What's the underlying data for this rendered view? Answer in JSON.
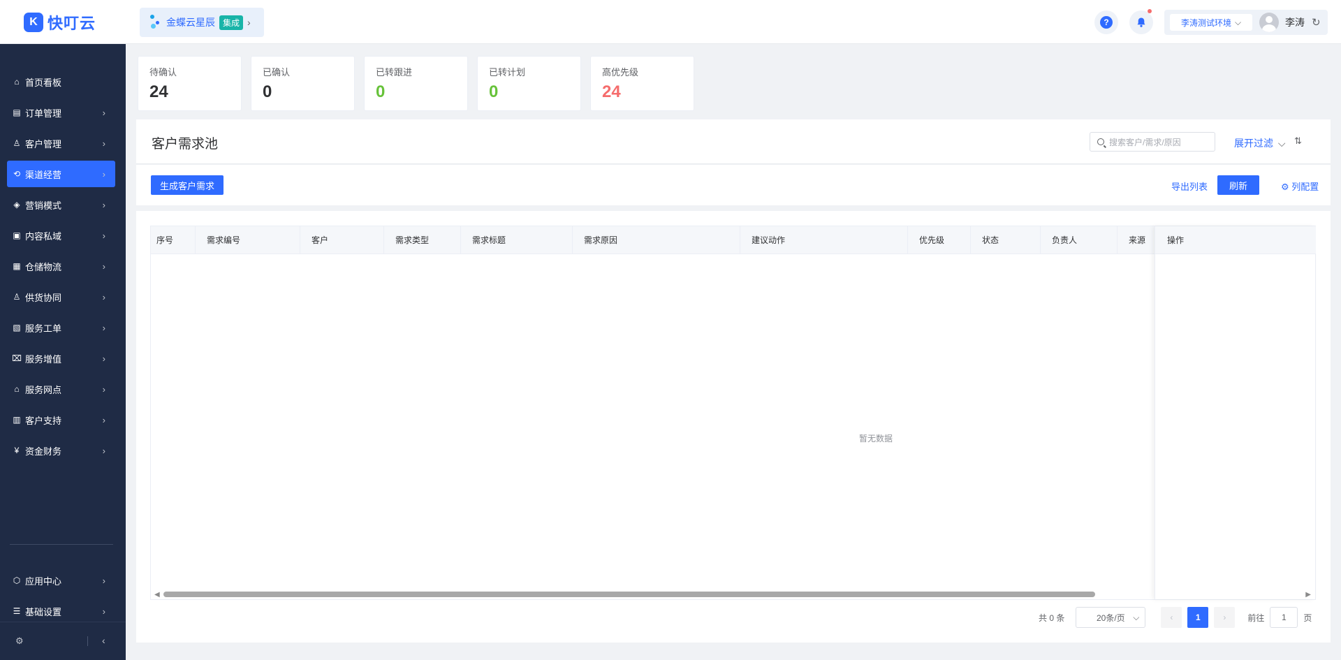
{
  "header": {
    "logo_text": "快叮云",
    "logo_glyph": "K",
    "integration": {
      "name": "金蝶云星辰",
      "badge": "集成"
    },
    "help_glyph": "?",
    "env_select": "李涛测试环境",
    "username": "李涛"
  },
  "sidebar": {
    "items": [
      {
        "label": "首页看板",
        "icon": "home-icon",
        "glyph": "⌂"
      },
      {
        "label": "订单管理",
        "icon": "order-icon",
        "glyph": "▤"
      },
      {
        "label": "客户管理",
        "icon": "user-icon",
        "glyph": "♙"
      },
      {
        "label": "渠道经营",
        "icon": "channel-icon",
        "glyph": "⟲",
        "active": true
      },
      {
        "label": "营销模式",
        "icon": "tag-icon",
        "glyph": "◈"
      },
      {
        "label": "内容私域",
        "icon": "image-icon",
        "glyph": "▣"
      },
      {
        "label": "仓储物流",
        "icon": "warehouse-icon",
        "glyph": "▦"
      },
      {
        "label": "供货协同",
        "icon": "supply-icon",
        "glyph": "♙"
      },
      {
        "label": "服务工单",
        "icon": "ticket-icon",
        "glyph": "▧"
      },
      {
        "label": "服务增值",
        "icon": "bag-icon",
        "glyph": "⌧"
      },
      {
        "label": "服务网点",
        "icon": "store-icon",
        "glyph": "⌂"
      },
      {
        "label": "客户支持",
        "icon": "support-icon",
        "glyph": "▥"
      },
      {
        "label": "资金财务",
        "icon": "finance-icon",
        "glyph": "¥"
      }
    ],
    "bottom_items": [
      {
        "label": "应用中心",
        "icon": "app-center-icon",
        "glyph": "⬡"
      },
      {
        "label": "基础设置",
        "icon": "settings-list-icon",
        "glyph": "☰"
      }
    ]
  },
  "stats": [
    {
      "label": "待确认",
      "value": "24",
      "color": "#303133"
    },
    {
      "label": "已确认",
      "value": "0",
      "color": "#303133"
    },
    {
      "label": "已转跟进",
      "value": "0",
      "color": "#67c23a"
    },
    {
      "label": "已转计划",
      "value": "0",
      "color": "#67c23a"
    },
    {
      "label": "高优先级",
      "value": "24",
      "color": "#f56c6c"
    }
  ],
  "panel": {
    "title": "客户需求池",
    "search_placeholder": "搜索客户/需求/原因",
    "expand_filter": "展开过滤",
    "generate_button": "生成客户需求",
    "export_button": "导出列表",
    "refresh_button": "刷新",
    "column_config": "列配置"
  },
  "table": {
    "columns": [
      "序号",
      "需求编号",
      "客户",
      "需求类型",
      "需求标题",
      "需求原因",
      "建议动作",
      "优先级",
      "状态",
      "负责人",
      "来源"
    ],
    "fixed_column": "操作",
    "empty_text": "暂无数据"
  },
  "pagination": {
    "total": "共 0 条",
    "page_size": "20条/页",
    "current_page": "1",
    "goto_label": "前往",
    "goto_value": "1",
    "page_suffix": "页"
  },
  "colors": {
    "primary": "#2f6bff",
    "sidebar_bg": "#1f2b45",
    "success": "#67c23a",
    "danger": "#f56c6c"
  }
}
